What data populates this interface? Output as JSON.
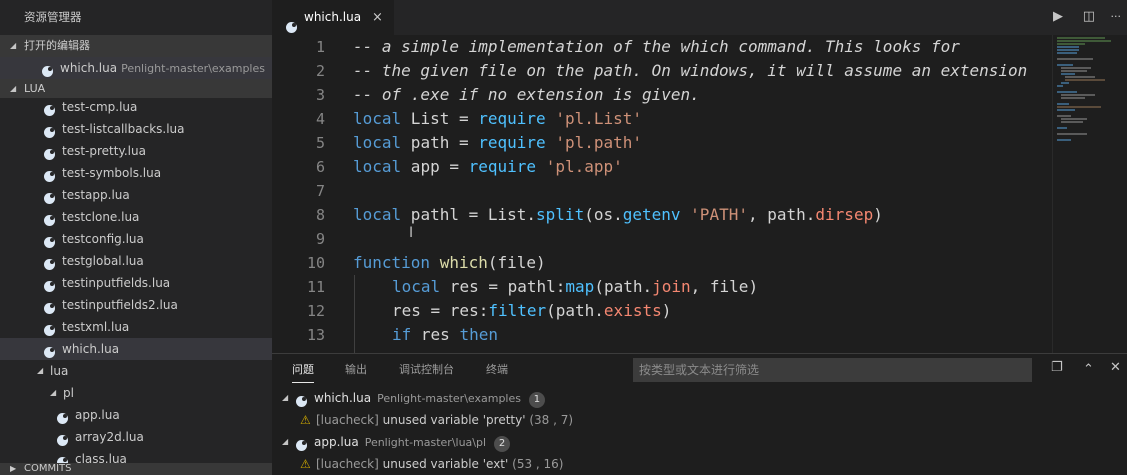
{
  "sidebar": {
    "title": "资源管理器",
    "open_editors_header": "打开的编辑器",
    "open_editor": {
      "name": "which.lua",
      "path": "Penlight-master\\examples"
    },
    "folder_header": "LUA",
    "files": [
      "test-cmp.lua",
      "test-listcallbacks.lua",
      "test-pretty.lua",
      "test-symbols.lua",
      "testapp.lua",
      "testclone.lua",
      "testconfig.lua",
      "testglobal.lua",
      "testinputfields.lua",
      "testinputfields2.lua",
      "testxml.lua",
      "which.lua"
    ],
    "folder_lua": "lua",
    "folder_pl": "pl",
    "pl_files": [
      "app.lua",
      "array2d.lua",
      "class.lua"
    ],
    "commits_header": "COMMITS"
  },
  "editor": {
    "tab_label": "which.lua",
    "tab_close": "×",
    "actions": {
      "run": "▶",
      "split": "◫",
      "more": "···"
    },
    "line_numbers": [
      "1",
      "2",
      "3",
      "4",
      "5",
      "6",
      "7",
      "8",
      "9",
      "10",
      "11",
      "12",
      "13"
    ],
    "code": {
      "l1": "-- a simple implementation of the which command. This looks for",
      "l2": "-- the given file on the path. On windows, it will assume an extension",
      "l3": "-- of .exe if no extension is given.",
      "l4": {
        "kw": "local",
        "name": " List = ",
        "call": "require",
        "str": "'pl.List'"
      },
      "l5": {
        "kw": "local",
        "name": " path = ",
        "call": "require",
        "str": "'pl.path'"
      },
      "l6": {
        "kw": "local",
        "name": " app = ",
        "call": "require",
        "str": "'pl.app'"
      },
      "l8": {
        "kw": "local",
        "a": " pathl = List.",
        "fn1": "split",
        "b": "(os.",
        "fn2": "getenv",
        "c": " ",
        "str": "'PATH'",
        "d": ", path.",
        "prop": "dirsep",
        "e": ")"
      },
      "l10": {
        "kw": "function",
        "sp": " ",
        "fn": "which",
        "rest": "(file)"
      },
      "l11": {
        "kw": "local",
        "a": " res = pathl:",
        "fn": "map",
        "b": "(path.",
        "prop": "join",
        "c": ", file)"
      },
      "l12": {
        "a": "res = res:",
        "fn": "filter",
        "b": "(path.",
        "prop": "exists",
        "c": ")"
      },
      "l13": {
        "kw1": "if",
        "a": " res ",
        "kw2": "then"
      }
    },
    "cursor_glyph": "I"
  },
  "panel": {
    "tabs": [
      "问题",
      "输出",
      "调试控制台",
      "终端"
    ],
    "filter_placeholder": "按类型或文本进行筛选",
    "actions": {
      "collapse_all": "❐",
      "maximize": "⌃",
      "close": "✕"
    },
    "groups": [
      {
        "file": "which.lua",
        "path": "Penlight-master\\examples",
        "count": "1",
        "problem": {
          "source": "[luacheck]",
          "message": "unused variable 'pretty'",
          "location": "(38 , 7)"
        }
      },
      {
        "file": "app.lua",
        "path": "Penlight-master\\lua\\pl",
        "count": "2",
        "problem": {
          "source": "[luacheck]",
          "message": "unused variable 'ext'",
          "location": "(53 , 16)"
        }
      }
    ]
  },
  "colors": {
    "comment": "#608b4e",
    "keyword": "#569cd6",
    "string": "#ce9178",
    "function": "#dcdcaa",
    "warning": "#cca700"
  }
}
